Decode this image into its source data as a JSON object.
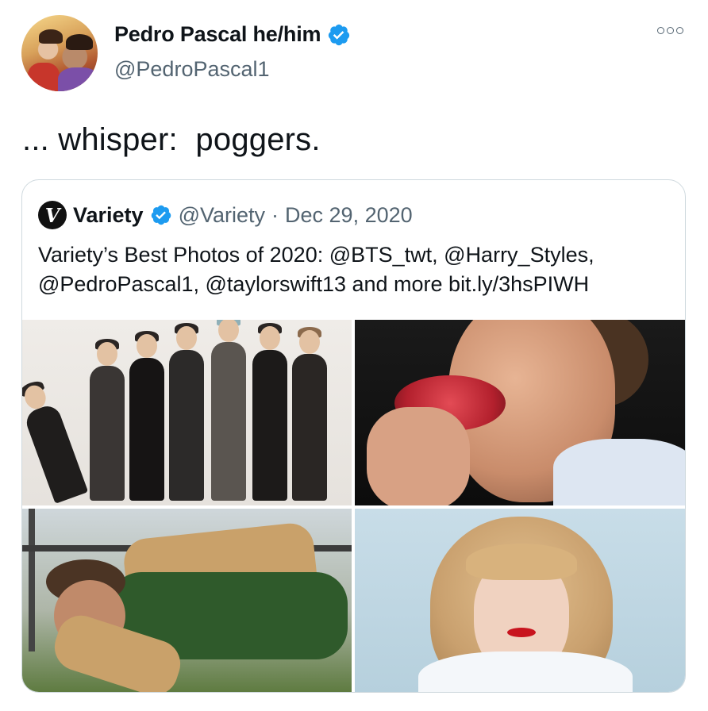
{
  "tweet": {
    "display_name": "Pedro Pascal he/him",
    "handle": "@PedroPascal1",
    "text": "... whisper:  poggers."
  },
  "quoted": {
    "logo_letter": "V",
    "name": "Variety",
    "handle": "@Variety",
    "separator": "·",
    "date": "Dec 29, 2020",
    "text_line1": "Variety’s Best Photos of 2020: @BTS_twt, @Harry_Styles,",
    "text_line2": "@PedroPascal1, @taylorswift13 and more bit.ly/3hsPIWH"
  },
  "colors": {
    "verified_blue": "#1d9bf0",
    "secondary_text": "#536471",
    "border": "#cfd9de"
  },
  "icons": [
    "verified-badge-icon",
    "more-options-icon",
    "variety-logo-icon"
  ]
}
